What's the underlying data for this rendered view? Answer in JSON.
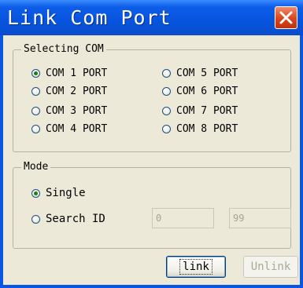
{
  "window": {
    "title": "Link Com Port"
  },
  "selecting_com": {
    "label": "Selecting COM",
    "ports": [
      {
        "label": "COM 1 PORT",
        "selected": true
      },
      {
        "label": "COM 2 PORT",
        "selected": false
      },
      {
        "label": "COM 3 PORT",
        "selected": false
      },
      {
        "label": "COM 4 PORT",
        "selected": false
      },
      {
        "label": "COM 5 PORT",
        "selected": false
      },
      {
        "label": "COM 6 PORT",
        "selected": false
      },
      {
        "label": "COM 7 PORT",
        "selected": false
      },
      {
        "label": "COM 8 PORT",
        "selected": false
      }
    ]
  },
  "mode": {
    "label": "Mode",
    "single_label": "Single",
    "search_label": "Search ID",
    "selected": "Single",
    "from_value": "0",
    "to_value": "99"
  },
  "buttons": {
    "link_label": "link",
    "unlink_label": "Unlink"
  },
  "colors": {
    "titlebar": "#0654de",
    "close_button": "#d9441c",
    "dialog_face": "#ece9d8"
  }
}
